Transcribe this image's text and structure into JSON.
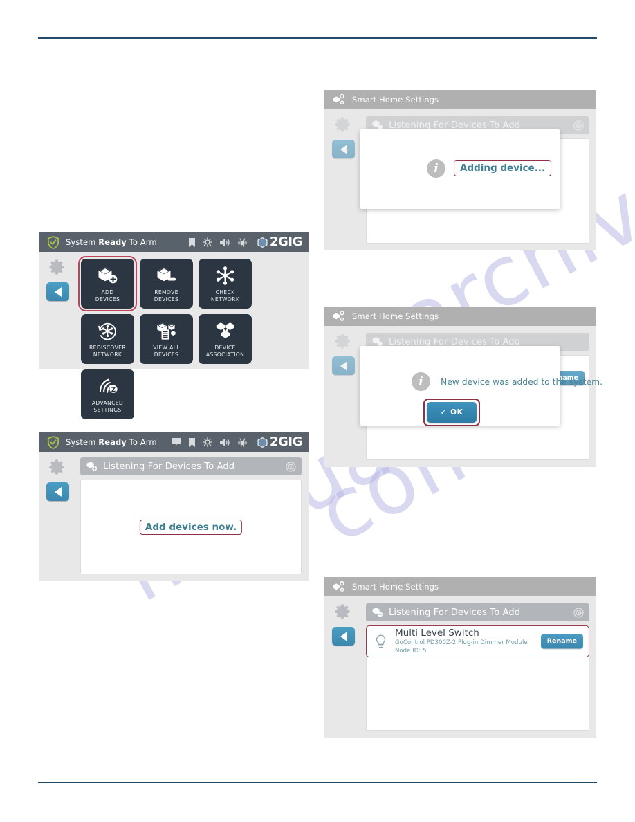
{
  "page": {
    "rules": {
      "color": "#234a68"
    },
    "watermark": [
      "manual",
      "archive",
      "com"
    ]
  },
  "panel1": {
    "statusbar": {
      "shield_icon": "shield-check-icon",
      "text_prefix": "System ",
      "text_bold": "Ready",
      "text_suffix": " To Arm",
      "icons": [
        "bookmark-icon",
        "brightness-icon",
        "volume-icon",
        "android-icon"
      ],
      "logo": "2GIG"
    },
    "rail": {
      "gear_icon": "gear-icon",
      "back_icon": "back-arrow-icon"
    },
    "tiles": [
      {
        "label_line1": "ADD",
        "label_line2": "DEVICES",
        "icon": "add-device-icon",
        "highlighted": true
      },
      {
        "label_line1": "REMOVE",
        "label_line2": "DEVICES",
        "icon": "remove-device-icon",
        "highlighted": false
      },
      {
        "label_line1": "CHECK",
        "label_line2": "NETWORK",
        "icon": "check-network-icon",
        "highlighted": false
      },
      {
        "label_line1": "REDISCOVER",
        "label_line2": "NETWORK",
        "icon": "rediscover-network-icon",
        "highlighted": false
      },
      {
        "label_line1": "VIEW ALL",
        "label_line2": "DEVICES",
        "icon": "view-all-devices-icon",
        "highlighted": false
      },
      {
        "label_line1": "DEVICE",
        "label_line2": "ASSOCIATION",
        "icon": "device-association-icon",
        "highlighted": false
      },
      {
        "label_line1": "ADVANCED",
        "label_line2": "SETTINGS",
        "icon": "advanced-settings-icon",
        "highlighted": false
      }
    ]
  },
  "panel2": {
    "statusbar": {
      "text_prefix": "System ",
      "text_bold": "Ready",
      "text_suffix": " To Arm",
      "icons": [
        "message-icon",
        "bookmark-icon",
        "brightness-icon",
        "volume-icon",
        "android-icon"
      ],
      "logo": "2GIG"
    },
    "listen_header": "Listening For Devices To Add",
    "callout": "Add devices now."
  },
  "panel3": {
    "titlebar": {
      "icon": "smart-home-icon",
      "title": "Smart Home Settings"
    },
    "listen_header": "Listening For Devices To Add",
    "dialog": {
      "info_icon": "info-icon",
      "message": "Adding device..."
    }
  },
  "panel4": {
    "titlebar": {
      "icon": "smart-home-icon",
      "title": "Smart Home Settings"
    },
    "listen_header": "Listening For Devices To Add",
    "dialog": {
      "info_icon": "info-icon",
      "message": "New device was added to the system.",
      "ok_label": "OK",
      "ok_check": "✓"
    },
    "behind_rename_button": "Rename"
  },
  "panel5": {
    "titlebar": {
      "icon": "smart-home-icon",
      "title": "Smart Home Settings"
    },
    "listen_header": "Listening For Devices To Add",
    "device": {
      "icon": "lightbulb-icon",
      "name": "Multi Level Switch",
      "model": "GoControl PD300Z-2 Plug-in Dimmer Module",
      "node": "Node ID: 5",
      "rename_label": "Rename"
    }
  }
}
